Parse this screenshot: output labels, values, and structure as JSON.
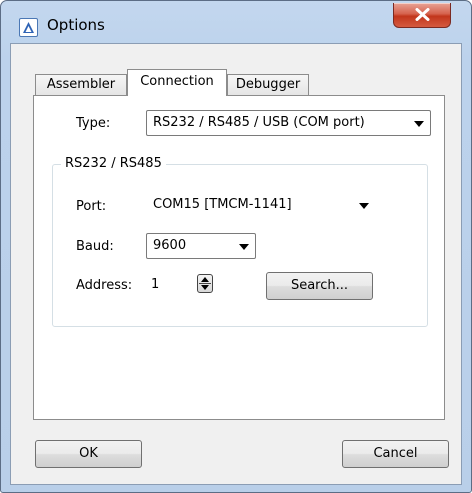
{
  "window": {
    "title": "Options",
    "icon": "triangle-app-icon",
    "close_icon": "close-x-icon"
  },
  "tabs": [
    {
      "label": "Assembler",
      "active": false
    },
    {
      "label": "Connection",
      "active": true
    },
    {
      "label": "Debugger",
      "active": false
    }
  ],
  "connection": {
    "type_label": "Type:",
    "type_value": "RS232 / RS485 / USB (COM port)",
    "group_title": "RS232 / RS485",
    "port_label": "Port:",
    "port_value": "COM15  [TMCM-1141]",
    "baud_label": "Baud:",
    "baud_value": "9600",
    "address_label": "Address:",
    "address_value": "1",
    "search_label": "Search..."
  },
  "footer": {
    "ok_label": "OK",
    "cancel_label": "Cancel"
  },
  "colors": {
    "title_frame": "#bcd2ec",
    "close_button": "#c2361c",
    "dialog_face": "#f0f0f0"
  }
}
